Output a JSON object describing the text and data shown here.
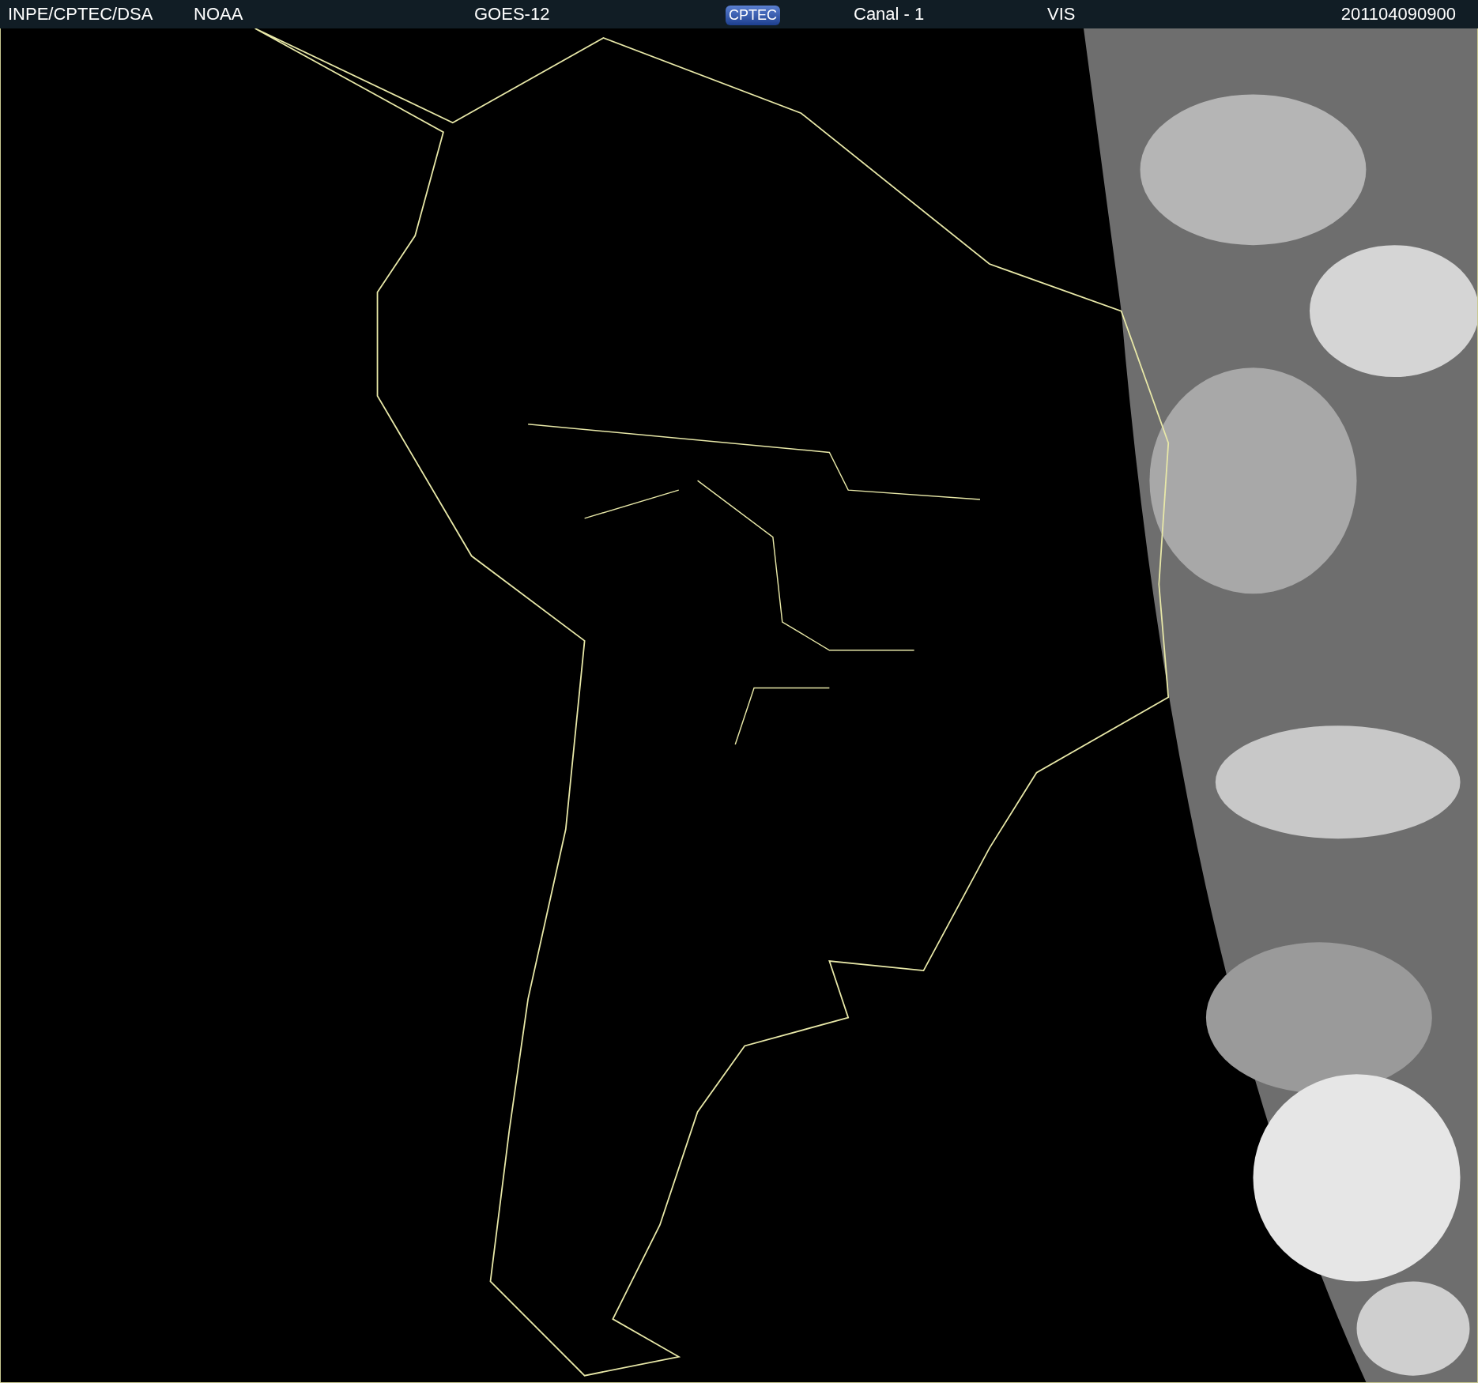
{
  "header": {
    "items": [
      {
        "kind": "text",
        "text": "INPE/CPTEC/DSA"
      },
      {
        "kind": "text",
        "text": "NOAA"
      },
      {
        "kind": "text",
        "text": "GOES-12"
      },
      {
        "kind": "logo",
        "text": "CPTEC"
      },
      {
        "kind": "text",
        "text": "Canal - 1"
      },
      {
        "kind": "text",
        "text": "VIS"
      },
      {
        "kind": "text",
        "text": "201104090900"
      }
    ]
  }
}
